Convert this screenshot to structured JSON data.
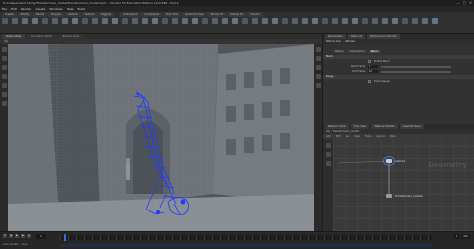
{
  "window": {
    "title": "E:/Independent Study/Transformers_model/Transformers_model.hiplc - Houdini FX Education Edition 19.0.498 - Py3.9",
    "controls": [
      "—",
      "□",
      "✕"
    ]
  },
  "menubar": {
    "items": [
      "File",
      "Edit",
      "Render",
      "Assets",
      "Windows",
      "Help",
      "Build"
    ]
  },
  "shelf": {
    "tabs": [
      "Create",
      "Modify",
      "Model",
      "Polygon",
      "Deform",
      "Texture",
      "Rigging",
      "Characters",
      "Constraints",
      "Hair Utils",
      "Guide Process",
      "Terrain FX",
      "Simple FX",
      "Volume"
    ],
    "icon_color": "#6a7c8f"
  },
  "viewport": {
    "tabs": [
      "Scene View",
      "Animation Editor",
      "Render View"
    ],
    "path_text": "obj",
    "view_label": "View"
  },
  "params": {
    "tabs": [
      "Parameters",
      "Take List",
      "Performance Monitor"
    ],
    "node_type": "Retime Sop",
    "node_name": "retime1",
    "subtabs": [
      "Retime",
      "Interpolation",
      "Blend"
    ],
    "section1": "Blend",
    "rows": [
      {
        "label": "Enable Blend",
        "value": ""
      },
      {
        "label": "Start Frame",
        "value": "1"
      },
      {
        "label": "End Frame",
        "value": "24"
      }
    ],
    "section2": "Range",
    "row3_label": "Frame Range"
  },
  "network": {
    "tabs": [
      "Network View",
      "Tree View",
      "Material Palette",
      "Asset Browser"
    ],
    "path": "obj › Transformers_model",
    "menu": [
      "Add",
      "Edit",
      "Go",
      "View",
      "Tools",
      "Layout",
      "Help"
    ],
    "watermark": "Geometry",
    "nodes": [
      {
        "label": "retime1",
        "color": "#9a9a9a"
      },
      {
        "label": "Transformers_model1",
        "color": "#9a9a9a"
      }
    ]
  },
  "timeline": {
    "current_frame": "1",
    "start": "1",
    "end": "240",
    "status": [
      "Auto Update",
      "Keys"
    ]
  },
  "colors": {
    "rig_blue": "#1e3cff",
    "accent": "#2f6fd6"
  }
}
